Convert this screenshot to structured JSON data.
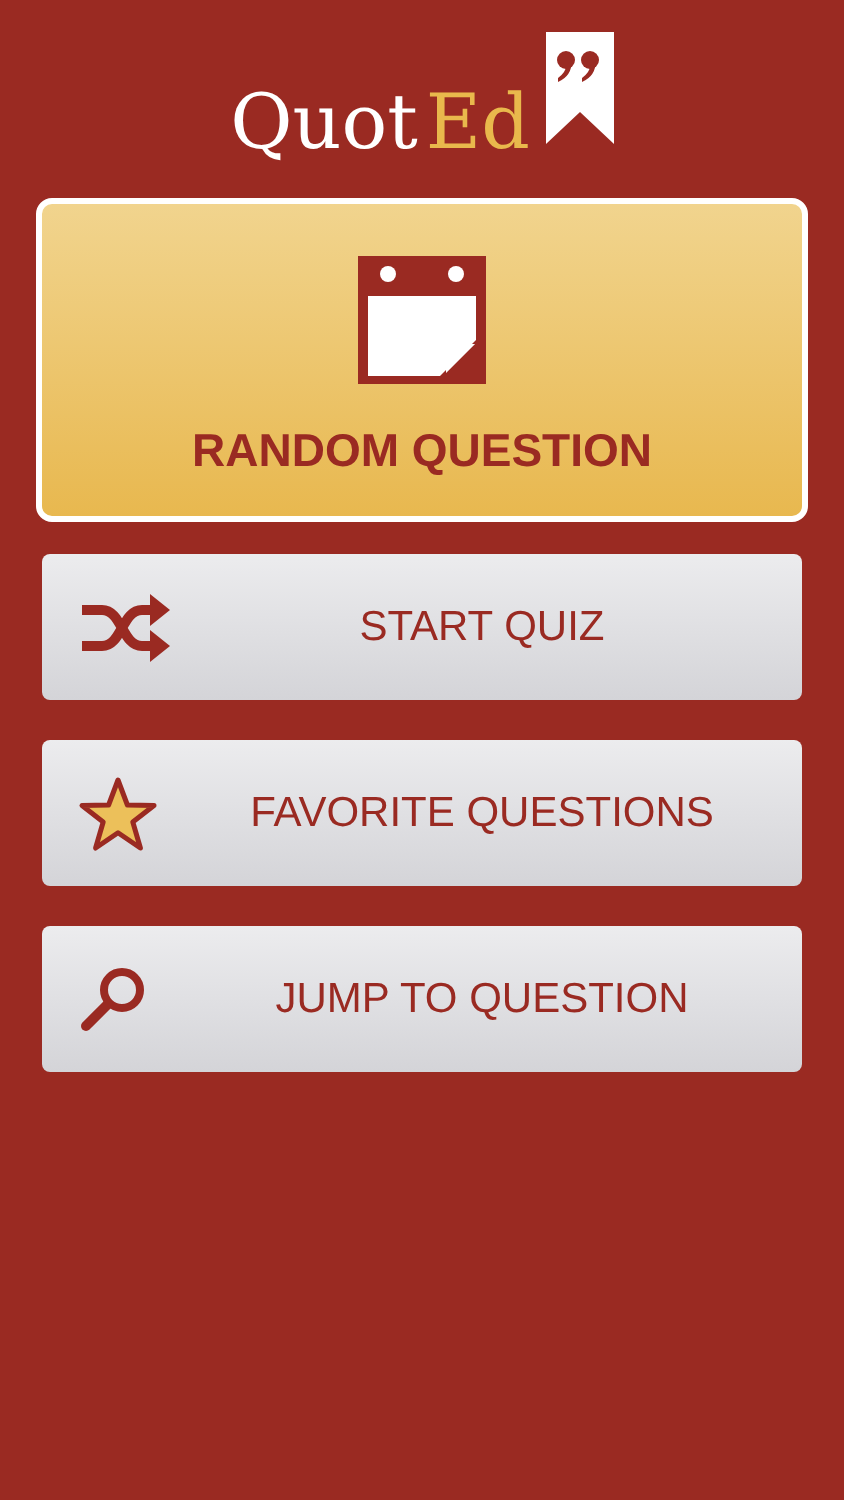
{
  "logo": {
    "first": "Quot",
    "second": "Ed"
  },
  "menu": [
    {
      "kind": "feature",
      "label": "RANDOM QUESTION"
    },
    {
      "kind": "item",
      "label": "START QUIZ"
    },
    {
      "kind": "item",
      "label": "FAVORITE QUESTIONS"
    },
    {
      "kind": "item",
      "label": "JUMP TO QUESTION"
    }
  ]
}
